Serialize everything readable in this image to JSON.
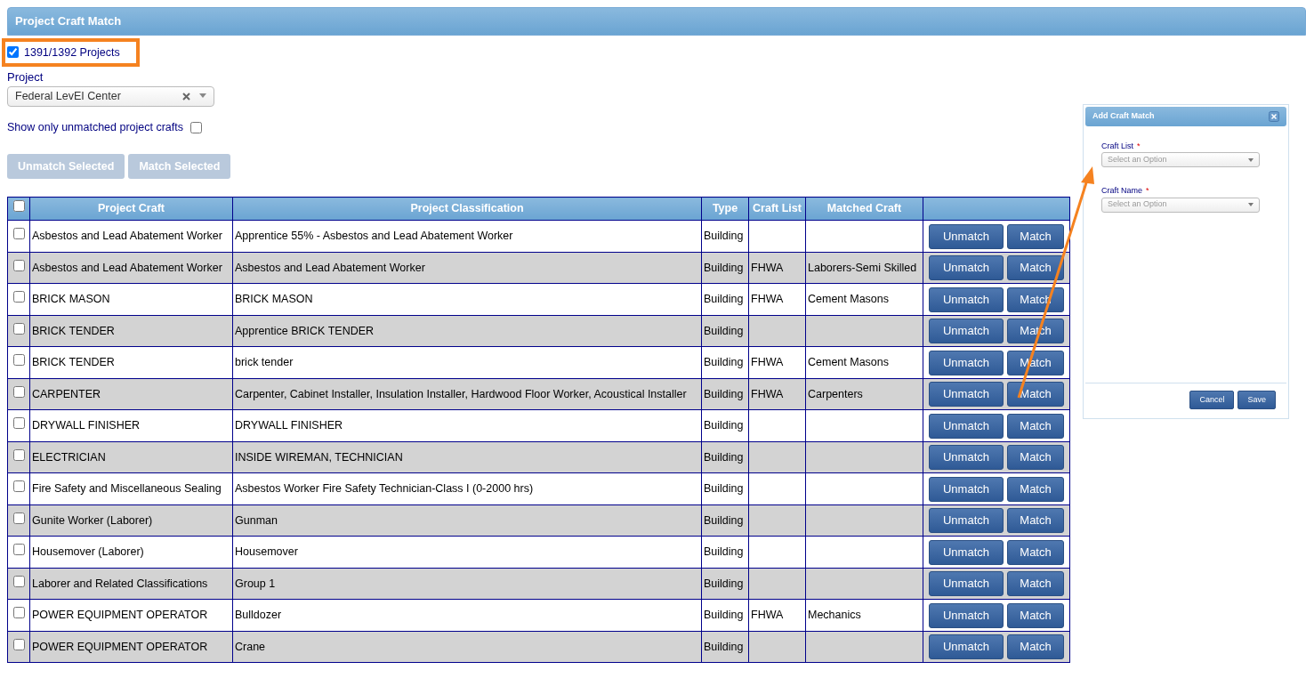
{
  "title": "Project Craft Match",
  "projects_toggle": {
    "label": "1391/1392 Projects",
    "checked": true
  },
  "project_field": {
    "label": "Project",
    "value": "Federal LevEI Center"
  },
  "unmatched_filter": {
    "label": "Show only unmatched project crafts",
    "checked": false
  },
  "bulk_buttons": [
    {
      "label": "Unmatch Selected",
      "disabled": true
    },
    {
      "label": "Match Selected",
      "disabled": true
    }
  ],
  "table": {
    "select_all": false,
    "columns": [
      "Project Craft",
      "Project Classification",
      "Type",
      "Craft List",
      "Matched Craft"
    ],
    "rows": [
      {
        "checked": false,
        "craft": "Asbestos and Lead Abatement Worker",
        "classification": "Apprentice 55% - Asbestos and Lead Abatement Worker",
        "type": "Building",
        "craft_list": "",
        "matched_craft": "",
        "buttons": [
          "Unmatch",
          "Match"
        ]
      },
      {
        "checked": false,
        "craft": "Asbestos and Lead Abatement Worker",
        "classification": "Asbestos and Lead Abatement Worker",
        "type": "Building",
        "craft_list": "FHWA",
        "matched_craft": "Laborers-Semi Skilled",
        "buttons": [
          "Unmatch",
          "Match"
        ]
      },
      {
        "checked": false,
        "craft": "BRICK MASON",
        "classification": "BRICK MASON",
        "type": "Building",
        "craft_list": "FHWA",
        "matched_craft": "Cement Masons",
        "buttons": [
          "Unmatch",
          "Match"
        ]
      },
      {
        "checked": false,
        "craft": "BRICK TENDER",
        "classification": "Apprentice BRICK TENDER",
        "type": "Building",
        "craft_list": "",
        "matched_craft": "",
        "buttons": [
          "Unmatch",
          "Match"
        ]
      },
      {
        "checked": false,
        "craft": "BRICK TENDER",
        "classification": "brick tender",
        "type": "Building",
        "craft_list": "FHWA",
        "matched_craft": "Cement Masons",
        "buttons": [
          "Unmatch",
          "Match"
        ]
      },
      {
        "checked": false,
        "craft": "CARPENTER",
        "classification": "Carpenter, Cabinet Installer, Insulation Installer, Hardwood Floor Worker, Acoustical Installer",
        "type": "Building",
        "craft_list": "FHWA",
        "matched_craft": "Carpenters",
        "buttons": [
          "Unmatch",
          "Match"
        ]
      },
      {
        "checked": false,
        "craft": "DRYWALL FINISHER",
        "classification": "DRYWALL FINISHER",
        "type": "Building",
        "craft_list": "",
        "matched_craft": "",
        "buttons": [
          "Unmatch",
          "Match"
        ]
      },
      {
        "checked": false,
        "craft": "ELECTRICIAN",
        "classification": "INSIDE WIREMAN, TECHNICIAN",
        "type": "Building",
        "craft_list": "",
        "matched_craft": "",
        "buttons": [
          "Unmatch",
          "Match"
        ]
      },
      {
        "checked": false,
        "craft": "Fire Safety and Miscellaneous Sealing",
        "classification": "Asbestos Worker Fire Safety Technician-Class I (0-2000 hrs)",
        "type": "Building",
        "craft_list": "",
        "matched_craft": "",
        "buttons": [
          "Unmatch",
          "Match"
        ]
      },
      {
        "checked": false,
        "craft": "Gunite Worker (Laborer)",
        "classification": "Gunman",
        "type": "Building",
        "craft_list": "",
        "matched_craft": "",
        "buttons": [
          "Unmatch",
          "Match"
        ]
      },
      {
        "checked": false,
        "craft": "Housemover (Laborer)",
        "classification": "Housemover",
        "type": "Building",
        "craft_list": "",
        "matched_craft": "",
        "buttons": [
          "Unmatch",
          "Match"
        ]
      },
      {
        "checked": false,
        "craft": "Laborer and Related Classifications",
        "classification": "Group 1",
        "type": "Building",
        "craft_list": "",
        "matched_craft": "",
        "buttons": [
          "Unmatch",
          "Match"
        ]
      },
      {
        "checked": false,
        "craft": "POWER EQUIPMENT OPERATOR",
        "classification": "Bulldozer",
        "type": "Building",
        "craft_list": "FHWA",
        "matched_craft": "Mechanics",
        "buttons": [
          "Unmatch",
          "Match"
        ]
      },
      {
        "checked": false,
        "craft": "POWER EQUIPMENT OPERATOR",
        "classification": "Crane",
        "type": "Building",
        "craft_list": "",
        "matched_craft": "",
        "buttons": [
          "Unmatch",
          "Match"
        ]
      }
    ]
  },
  "dialog": {
    "title": "Add Craft Match",
    "fields": [
      {
        "label": "Craft List",
        "required_mark": "*",
        "placeholder": "Select an Option"
      },
      {
        "label": "Craft Name",
        "required_mark": "*",
        "placeholder": "Select an Option"
      }
    ],
    "buttons": [
      "Cancel",
      "Save"
    ]
  }
}
